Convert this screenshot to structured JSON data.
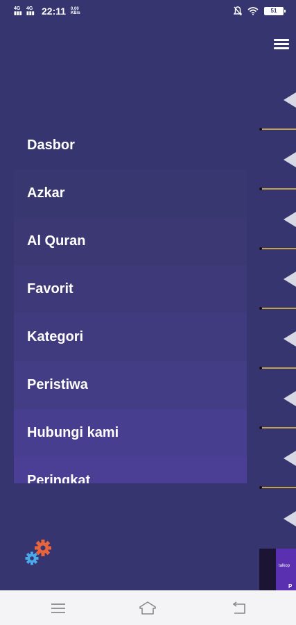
{
  "status_bar": {
    "signal1": "4G",
    "signal2": "4G",
    "time": "22:11",
    "speed_value": "0.00",
    "speed_unit": "KB/s",
    "battery": "51"
  },
  "menu": {
    "items": [
      {
        "label": "Dasbor"
      },
      {
        "label": "Azkar"
      },
      {
        "label": "Al Quran"
      },
      {
        "label": "Favorit"
      },
      {
        "label": "Kategori"
      },
      {
        "label": "Peristiwa"
      },
      {
        "label": "Hubungi kami"
      },
      {
        "label": "Peringkat"
      }
    ]
  },
  "ad": {
    "text": "talkop",
    "letter": "P"
  },
  "icons": {
    "hamburger": "menu-icon",
    "settings": "gears-icon",
    "nav_menu": "menu-lines-icon",
    "nav_home": "home-icon",
    "nav_back": "back-icon"
  },
  "colors": {
    "background": "#363570",
    "menu_highlight": "#4a3f94",
    "gear_orange": "#e8643c",
    "gear_blue": "#4aa9e8",
    "accent_line": "#c2a24a"
  }
}
